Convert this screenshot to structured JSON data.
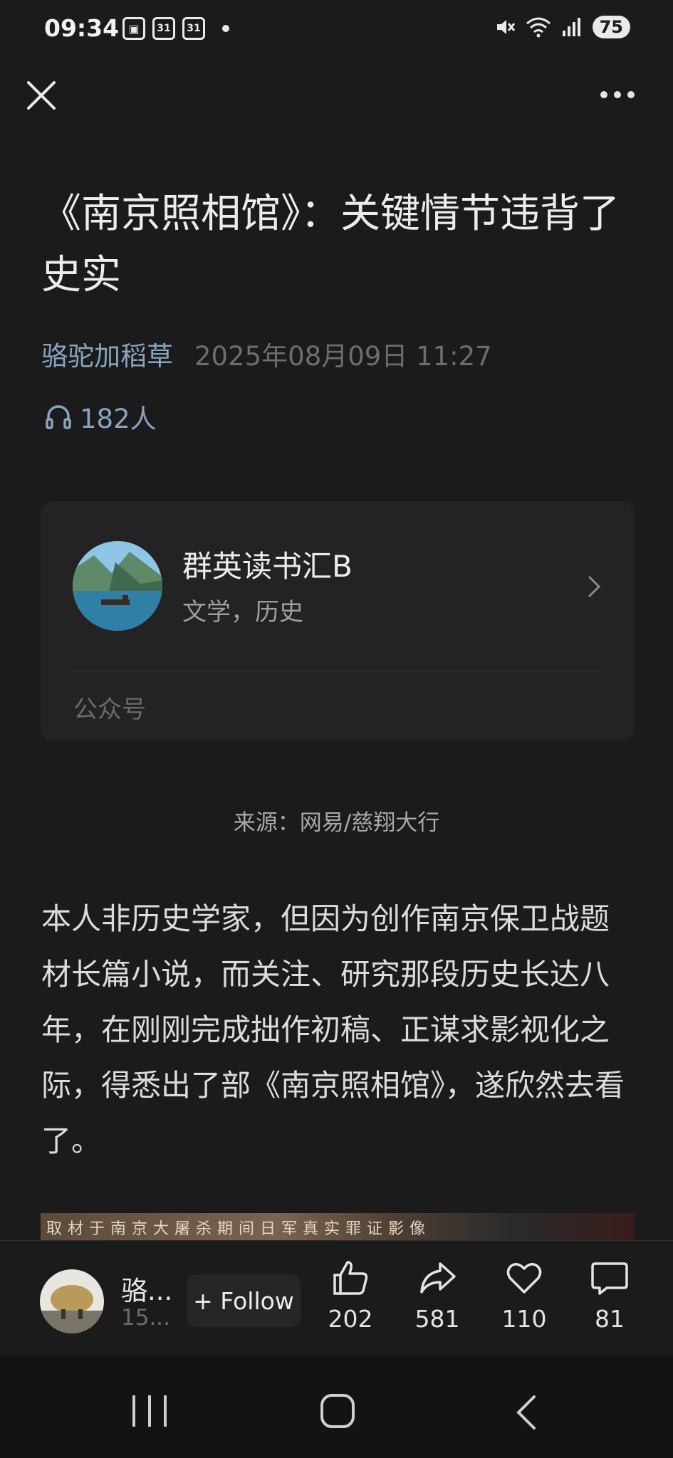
{
  "status_bar": {
    "time": "09:34",
    "calendar_1": "31",
    "calendar_2": "31",
    "battery": "75"
  },
  "article": {
    "title": "《南京照相馆》：关键情节违背了史实",
    "author": "骆驼加稻草",
    "date": "2025年08月09日 11:27",
    "listeners": "182人",
    "source": "来源：网易/慈翔大行",
    "body": "本人非历史学家，但因为创作南京保卫战题材长篇小说，而关注、研究那段历史长达八年，在刚刚完成拙作初稿、正谋求影视化之际，得悉出了部《南京照相馆》，遂欣然去看了。",
    "image_caption": "取材于南京大屠杀期间日军真实罪证影像"
  },
  "account_card": {
    "name": "群英读书汇B",
    "tags": "文学，历史",
    "type": "公众号"
  },
  "action_bar": {
    "author_name": "骆...",
    "author_sub": "15...",
    "follow_label": "+ Follow",
    "likes": "202",
    "shares": "581",
    "favorites": "110",
    "comments": "81"
  },
  "colors": {
    "background": "#1b1b1b",
    "link": "#8aa3c0",
    "muted": "#6d6d6d"
  }
}
